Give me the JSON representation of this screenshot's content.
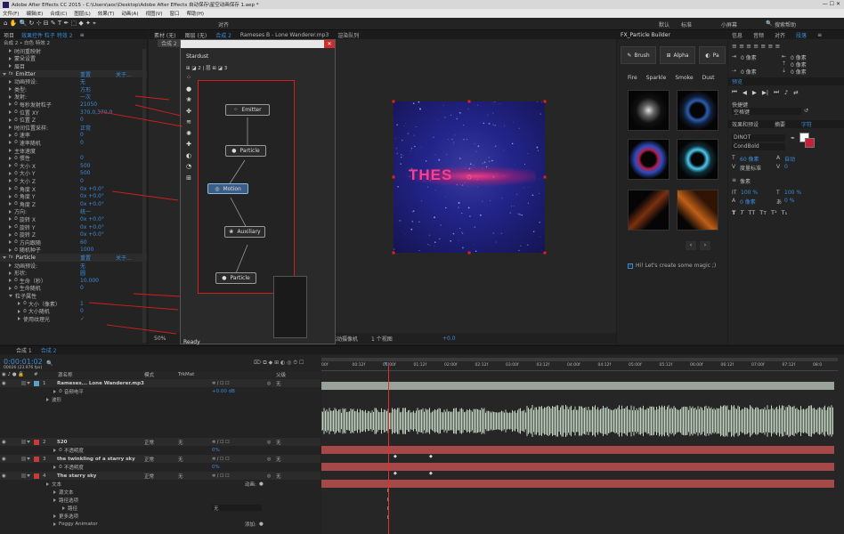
{
  "window": {
    "title": "Adobe After Effects CC 2015 - C:\\Users\\aoc\\Desktop\\Adobe After Effects 自动保存\\星空动画保存 1.aep *"
  },
  "menu": [
    "文件(F)",
    "编辑(E)",
    "合成(C)",
    "图层(L)",
    "效果(T)",
    "动画(A)",
    "视图(V)",
    "窗口",
    "帮助(H)"
  ],
  "toolbar": {
    "align_label": "对齐",
    "default_label": "默认",
    "standard_label": "标准",
    "small_screen_label": "小屏幕",
    "search_placeholder": "搜索帮助"
  },
  "effects_panel": {
    "tabs": [
      "项目",
      "效果控件 粒子 特效 2",
      "≡"
    ],
    "breadcrumb": "合成 2 • 白色 特效 2",
    "top_rows": [
      "时间重映射",
      "蒙朵设置",
      "眉目"
    ],
    "emitter_header": "Emitter",
    "reset": "重置",
    "about": "关于...",
    "emitter_rows": [
      {
        "label": "动画预设:",
        "value": "无"
      },
      {
        "label": "类型:",
        "value": "方形"
      },
      {
        "label": "发射:",
        "value": "一次"
      },
      {
        "label": "每秒发射粒子",
        "value": "21050"
      },
      {
        "label": "位置 XY",
        "value": "370.0,370.0"
      },
      {
        "label": "位置 Z",
        "value": "0"
      },
      {
        "label": "时间位置采样:",
        "value": "正常"
      },
      {
        "label": "速率",
        "value": "0"
      },
      {
        "label": "速率随机",
        "value": "0"
      },
      {
        "label": "主体速度",
        "value": ""
      },
      {
        "label": "惯性",
        "value": "0"
      },
      {
        "label": "大小 X",
        "value": "500"
      },
      {
        "label": "大小 Y",
        "value": "500"
      },
      {
        "label": "大小 Z",
        "value": "0"
      },
      {
        "label": "角度 X",
        "value": "0x +0.0°"
      },
      {
        "label": "角度 Y",
        "value": "0x +0.0°"
      },
      {
        "label": "角度 Z",
        "value": "0x +0.0°"
      },
      {
        "label": "方向:",
        "value": "统一"
      },
      {
        "label": "旋转 X",
        "value": "0x +0.0°"
      },
      {
        "label": "旋转 Y",
        "value": "0x +0.0°"
      },
      {
        "label": "旋转 Z",
        "value": "0x +0.0°"
      },
      {
        "label": "方向跟随",
        "value": "60"
      },
      {
        "label": "随机种子",
        "value": "1000"
      }
    ],
    "particle_header": "Particle",
    "particle_rows": [
      {
        "label": "动画预设:",
        "value": "无"
      },
      {
        "label": "形状:",
        "value": "圆"
      },
      {
        "label": "生命（秒）",
        "value": "10.000"
      },
      {
        "label": "生命随机",
        "value": "0"
      },
      {
        "label": "粒子属性",
        "value": ""
      },
      {
        "label": "大小（像素）",
        "value": "1"
      },
      {
        "label": "大小随机",
        "value": "0"
      },
      {
        "label": "使用纹理光",
        "value": "✓"
      }
    ]
  },
  "stardust": {
    "title": "Stardust",
    "subtitle": "⊞ ◪ 2 | 层 ⊞ ◪ 3",
    "status": "Ready",
    "nodes": [
      "Emitter",
      "Particle",
      "Motion",
      "Auxiliary",
      "Particle"
    ]
  },
  "composition": {
    "tabs": [
      "素材 (无)",
      "图层 (无)",
      "合成 2",
      "Rameses B - Lone Wanderer.mp3",
      "渲染队列"
    ],
    "sub_tab": "合成 2",
    "preview_text": "THES",
    "zoom": "50%",
    "camera": "活动摄像机",
    "views": "1 个视图",
    "exposure": "+0.0"
  },
  "fx_builder": {
    "title": "FX_Particle Builder",
    "buttons": [
      "Brush",
      "Alpha",
      "Pa"
    ],
    "tabs": [
      "Fire",
      "Sparkle",
      "Smoke",
      "Dust"
    ],
    "status": "Hi! Let's create some magic ;)"
  },
  "right_panels": {
    "tabs": [
      "信息",
      "音频",
      "对齐",
      "段落",
      "≡"
    ],
    "spacing": [
      "0 像素",
      "0 像素",
      "0 像素",
      "0 像素",
      "0 像素"
    ],
    "preview_tab": "预览",
    "shortcut_label": "快捷键",
    "shortcut_value": "空格键",
    "effects_tabs": [
      "效果和预设",
      "摘要",
      "字符"
    ],
    "font_name": "DINOT",
    "font_style": "CondBold",
    "font_size": "60 像素",
    "leading": "自动",
    "tracking": "0",
    "kern": "度量标准",
    "stroke": "像素",
    "scale_v": "100 %",
    "scale_h": "100 %",
    "baseline": "0 像素",
    "tsume": "0 %"
  },
  "timeline": {
    "tabs": [
      "合成 1",
      "合成 2"
    ],
    "timecode": "0:00:01:02",
    "fps": "00026 (23.976 fps)",
    "col_name": "源名称",
    "col_mode": "模式",
    "col_trkmat": "TrkMat",
    "col_parent": "父级",
    "none": "无",
    "normal": "正常",
    "ruler": [
      "00f",
      "00:12f",
      "01:00f",
      "01:12f",
      "02:00f",
      "02:12f",
      "03:00f",
      "03:12f",
      "04:00f",
      "04:12f",
      "05:00f",
      "05:12f",
      "06:00f",
      "06:12f",
      "07:00f",
      "07:12f",
      "08:0"
    ],
    "layers": [
      {
        "num": "1",
        "name": "Rameses... Lone Wanderer.mp3",
        "color": "#5aa0c8"
      },
      {
        "num": "2",
        "name": "520",
        "color": "#c83a3a"
      },
      {
        "num": "3",
        "name": "the twinkling of a starry sky",
        "color": "#c83a3a"
      },
      {
        "num": "4",
        "name": "The starry sky",
        "color": "#c83a3a"
      }
    ],
    "audio_level": "音频电平",
    "audio_level_value": "+0.00 dB",
    "waveform": "波形",
    "opacity": "不透明度",
    "opacity_value": "0%",
    "text": "文本",
    "source_text": "源文本",
    "path_options": "路径选项",
    "path": "路径",
    "more_options": "更多选项",
    "animator": "Foggy Animator",
    "animate_label": "动画:",
    "add_label": "添加:"
  },
  "colors": {
    "accent": "#3b8bd8",
    "layer_red": "#c83a3a",
    "waveform": "#c3d4c0",
    "playhead": "#e03030",
    "comp_bg": "#1c2266"
  }
}
